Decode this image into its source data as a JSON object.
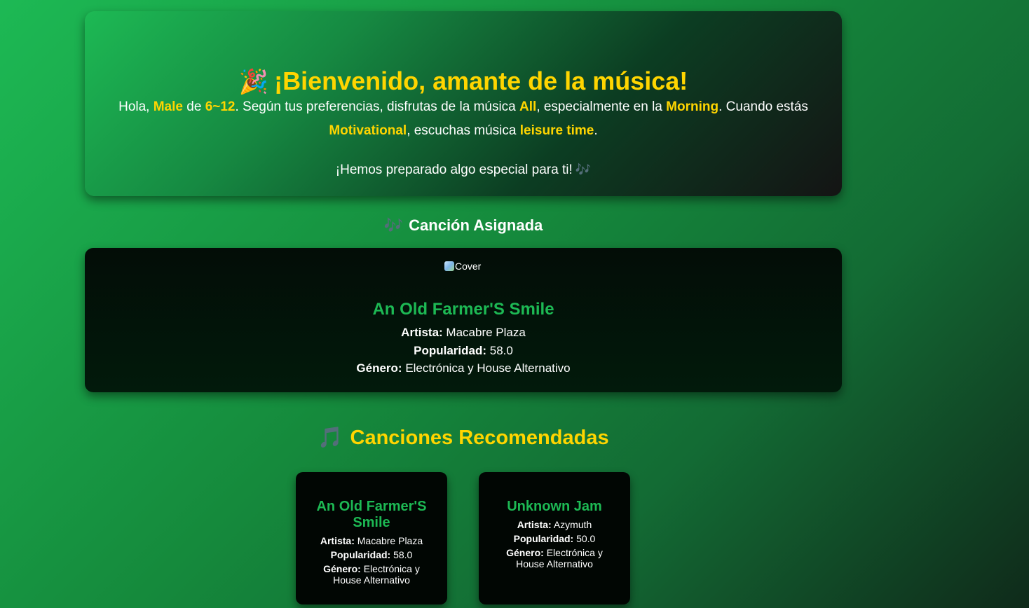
{
  "welcome": {
    "emoji": "🎉",
    "title": "¡Bienvenido, amante de la música!",
    "intro_1": "Hola, ",
    "gender": "Male",
    "intro_2": " de ",
    "age": "6~12",
    "intro_3": ". Según tus preferencias, disfrutas de la música ",
    "genre_pref": "All",
    "intro_4": ", especialmente en la ",
    "time_pref": "Morning",
    "intro_5": ". Cuando estás ",
    "mood": "Motivational",
    "intro_6": ", escuchas música ",
    "activity": "leisure time",
    "intro_7": ".",
    "special": "¡Hemos preparado algo especial para ti!",
    "special_icon": "🎶"
  },
  "assigned": {
    "heading_icon": "🎶",
    "heading": "Canción Asignada",
    "cover_alt": "Cover",
    "title": "An Old Farmer'S Smile",
    "artist_label": "Artista:",
    "artist": "Macabre Plaza",
    "popularity_label": "Popularidad:",
    "popularity": "58.0",
    "genre_label": "Género:",
    "genre": "Electrónica y House Alternativo"
  },
  "recommended": {
    "heading_icon": "🎵",
    "heading": "Canciones Recomendadas",
    "cards": [
      {
        "title": "An Old Farmer'S Smile",
        "artist_label": "Artista:",
        "artist": "Macabre Plaza",
        "popularity_label": "Popularidad:",
        "popularity": "58.0",
        "genre_label": "Género:",
        "genre": "Electrónica y House Alternativo"
      },
      {
        "title": "Unknown Jam",
        "artist_label": "Artista:",
        "artist": "Azymuth",
        "popularity_label": "Popularidad:",
        "popularity": "50.0",
        "genre_label": "Género:",
        "genre": "Electrónica y House Alternativo"
      }
    ]
  },
  "colors": {
    "accent_green": "#1db954",
    "highlight_yellow": "#ffd500"
  }
}
